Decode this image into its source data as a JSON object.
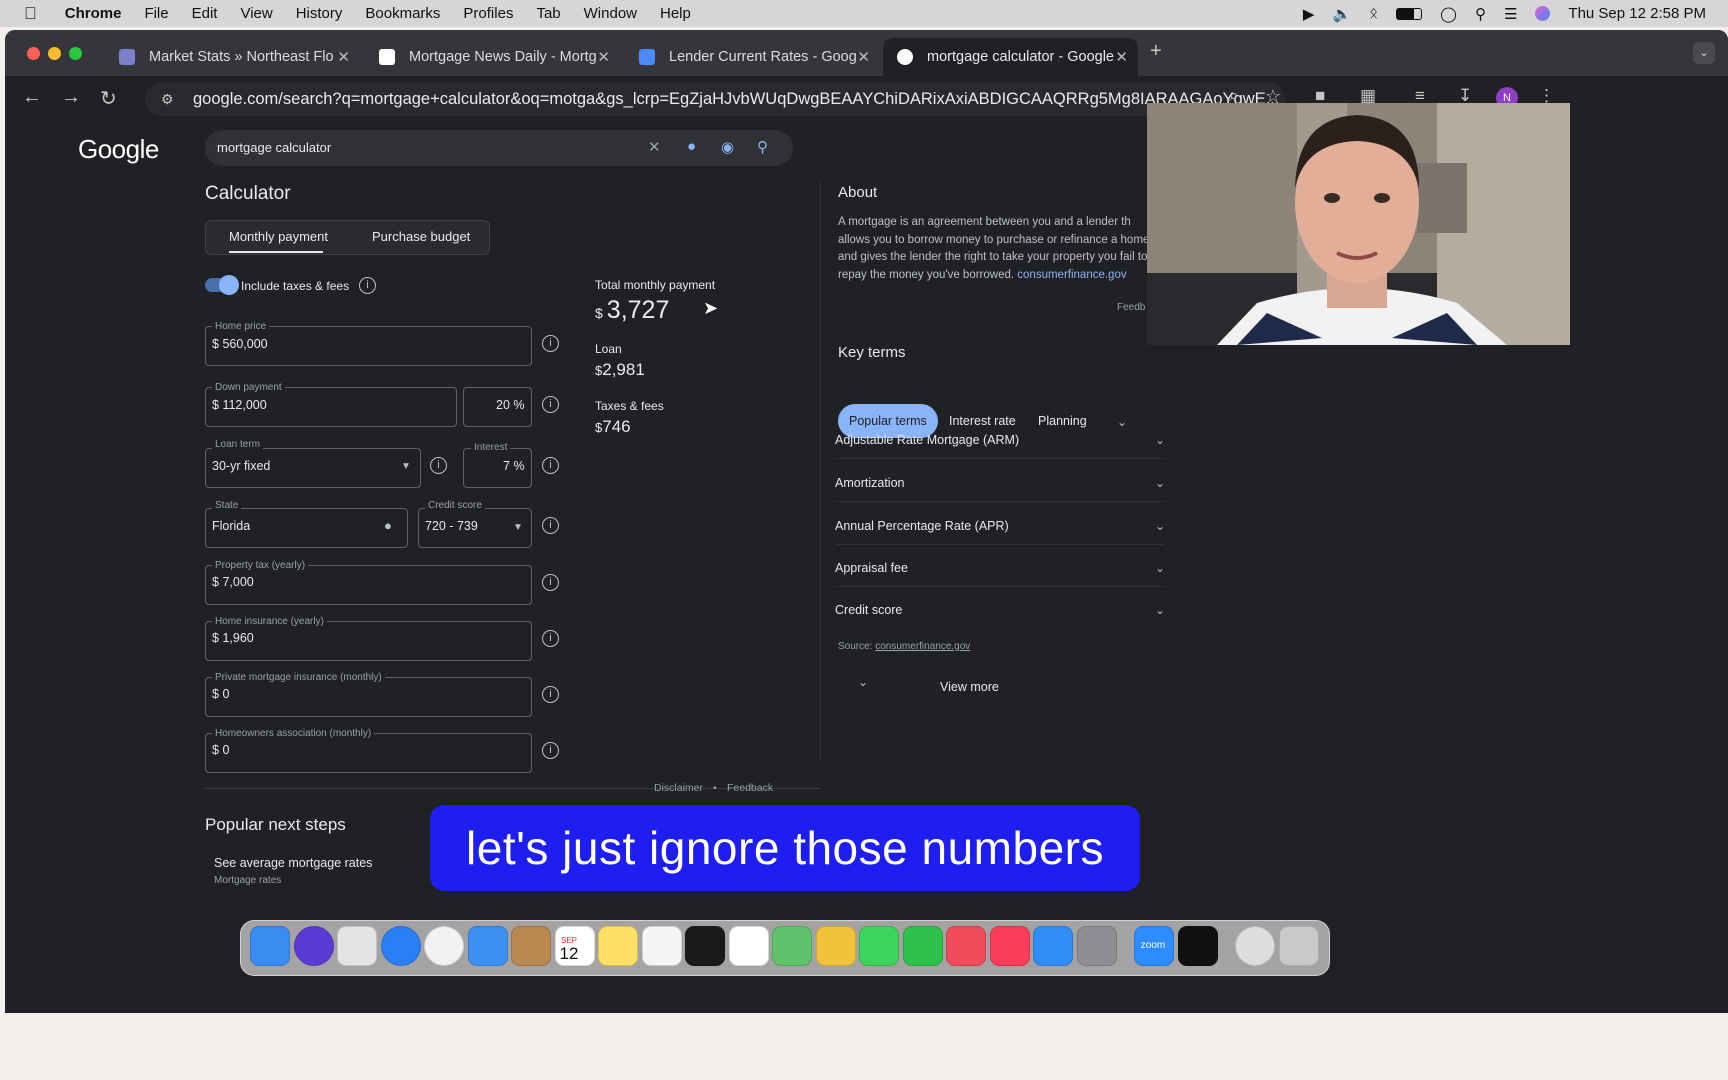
{
  "menubar": {
    "app_name": "Chrome",
    "items": [
      "File",
      "Edit",
      "View",
      "History",
      "Bookmarks",
      "Profiles",
      "Tab",
      "Window",
      "Help"
    ],
    "datetime": "Thu Sep 12  2:58 PM"
  },
  "tabs": [
    {
      "title": "Market Stats » Northeast Flo",
      "icon": "document-icon",
      "color": "#7b7fc9"
    },
    {
      "title": "Mortgage News Daily - Mortg",
      "icon": "news-icon",
      "color": "#ffffff"
    },
    {
      "title": "Lender Current Rates - Goog",
      "icon": "google-docs-icon",
      "color": "#4c8bf5"
    },
    {
      "title": "mortgage calculator - Google",
      "icon": "google-g-icon",
      "color": "#ffffff",
      "active": true
    }
  ],
  "address": {
    "url": "google.com/search?q=mortgage+calculator&oq=motga&gs_lcrp=EgZjaHJvbWUqDwgBEAAYChiDARixAxiABDIGCAAQRRg5Mg8IARAAGAoYgwE..."
  },
  "search": {
    "logo": "Google",
    "query": "mortgage calculator"
  },
  "calculator": {
    "title": "Calculator",
    "tab_monthly": "Monthly payment",
    "tab_budget": "Purchase budget",
    "toggle_label": "Include taxes & fees",
    "home_price_label": "Home price",
    "home_price": "560,000",
    "down_payment_label": "Down payment",
    "down_payment": "112,000",
    "down_percent": "20",
    "loan_term_label": "Loan term",
    "loan_term": "30-yr fixed",
    "interest_label": "Interest",
    "interest": "7",
    "state_label": "State",
    "state": "Florida",
    "credit_label": "Credit score",
    "credit": "720 - 739",
    "property_tax_label": "Property tax (yearly)",
    "property_tax": "7,000",
    "insurance_label": "Home insurance (yearly)",
    "insurance": "1,960",
    "pmi_label": "Private mortgage insurance (monthly)",
    "pmi": "0",
    "hoa_label": "Homeowners association (monthly)",
    "hoa": "0",
    "currency": "$",
    "percent": "%"
  },
  "results": {
    "total_label": "Total monthly payment",
    "total": "3,727",
    "loan_label": "Loan",
    "loan": "2,981",
    "taxes_label": "Taxes & fees",
    "taxes": "746"
  },
  "about": {
    "title": "About",
    "text": "A mortgage is an agreement between you and a lender th allows you to borrow money to purchase or refinance a home and gives the lender the right to take your property you fail to repay the money you've borrowed.",
    "link": "consumerfinance.gov",
    "feedback": "Feedb"
  },
  "key_terms": {
    "title": "Key terms",
    "pills": [
      "Popular terms",
      "Interest rate",
      "Planning"
    ],
    "terms": [
      "Adjustable Rate Mortgage (ARM)",
      "Amortization",
      "Annual Percentage Rate (APR)",
      "Appraisal fee",
      "Credit score"
    ],
    "source_label": "Source:",
    "source_link": "consumerfinance.gov",
    "view_more": "View more"
  },
  "footer": {
    "disclaimer": "Disclaimer",
    "feedback": "Feedback",
    "popular_title": "Popular next steps",
    "step_title": "See average mortgage rates",
    "step_sub": "Mortgage rates"
  },
  "caption": "let's just ignore those numbers",
  "dock": {
    "calendar_month": "SEP",
    "calendar_day": "12",
    "zoom": "zoom",
    "apps": [
      {
        "name": "finder",
        "color": "#3b8cf0"
      },
      {
        "name": "siri",
        "color": "#5b3bd6"
      },
      {
        "name": "launchpad",
        "color": "#e4e4e4"
      },
      {
        "name": "safari",
        "color": "#2a7ff5"
      },
      {
        "name": "chrome",
        "color": "#f2f2f2"
      },
      {
        "name": "mail",
        "color": "#3d8ff2"
      },
      {
        "name": "contacts",
        "color": "#b98850"
      },
      {
        "name": "calendar",
        "color": "#ffffff"
      },
      {
        "name": "notes",
        "color": "#ffe066"
      },
      {
        "name": "freeform",
        "color": "#f5f5f5"
      },
      {
        "name": "tv",
        "color": "#1a1a1a"
      },
      {
        "name": "reminders",
        "color": "#ffffff"
      },
      {
        "name": "maps",
        "color": "#5ec36a"
      },
      {
        "name": "photos",
        "color": "#f3c23d"
      },
      {
        "name": "messages",
        "color": "#3ed35a"
      },
      {
        "name": "facetime",
        "color": "#2fc24a"
      },
      {
        "name": "news",
        "color": "#f04b5a"
      },
      {
        "name": "music",
        "color": "#fb3d57"
      },
      {
        "name": "app-store",
        "color": "#2f8ef5"
      },
      {
        "name": "settings",
        "color": "#8e8e93"
      },
      {
        "name": "zoom",
        "color": "#2d8cff"
      },
      {
        "name": "capcut",
        "color": "#111111"
      },
      {
        "name": "activity",
        "color": "#dddddd"
      },
      {
        "name": "trash",
        "color": "#c9c9c9"
      }
    ]
  }
}
